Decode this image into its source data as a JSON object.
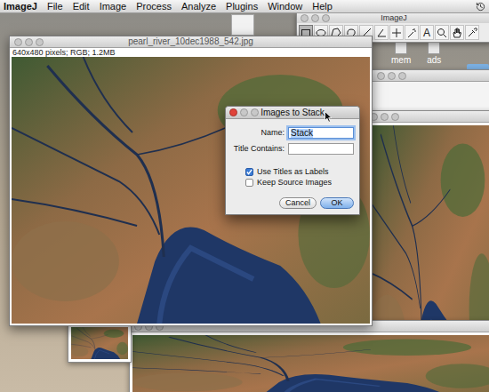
{
  "menu_bar": {
    "app": "ImageJ",
    "items": [
      "File",
      "Edit",
      "Image",
      "Process",
      "Analyze",
      "Plugins",
      "Window",
      "Help"
    ]
  },
  "desktop_icons": [
    {
      "label": "mem"
    },
    {
      "label": "ads"
    }
  ],
  "toolbar_window": {
    "title": "ImageJ",
    "active": false,
    "tools": [
      {
        "kind": "rectangle",
        "selected": true
      },
      {
        "kind": "oval",
        "selected": false
      },
      {
        "kind": "polygon",
        "selected": false
      },
      {
        "kind": "freehand",
        "selected": false
      },
      {
        "kind": "line",
        "selected": false
      },
      {
        "kind": "angle",
        "selected": false
      },
      {
        "kind": "point",
        "selected": false
      },
      {
        "kind": "wand",
        "selected": false
      },
      {
        "kind": "text",
        "label": "A",
        "selected": false
      },
      {
        "kind": "magnifier",
        "selected": false
      },
      {
        "kind": "hand",
        "selected": false
      },
      {
        "kind": "dropper",
        "selected": false
      }
    ]
  },
  "image_window": {
    "title": "pearl_river_10dec1988_542.jpg",
    "info": "640x480 pixels; RGB; 1.2MB",
    "active": false
  },
  "dialog": {
    "title": "Images to Stack",
    "active": true,
    "fields": [
      {
        "label": "Name:",
        "value": "Stack",
        "selected": true
      },
      {
        "label": "Title Contains:",
        "value": "",
        "selected": false
      }
    ],
    "checkboxes": [
      {
        "label": "Use Titles as Labels",
        "checked": true
      },
      {
        "label": "Keep Source Images",
        "checked": false
      }
    ],
    "buttons": [
      {
        "label": "Cancel",
        "default": false
      },
      {
        "label": "OK",
        "default": true
      }
    ]
  }
}
